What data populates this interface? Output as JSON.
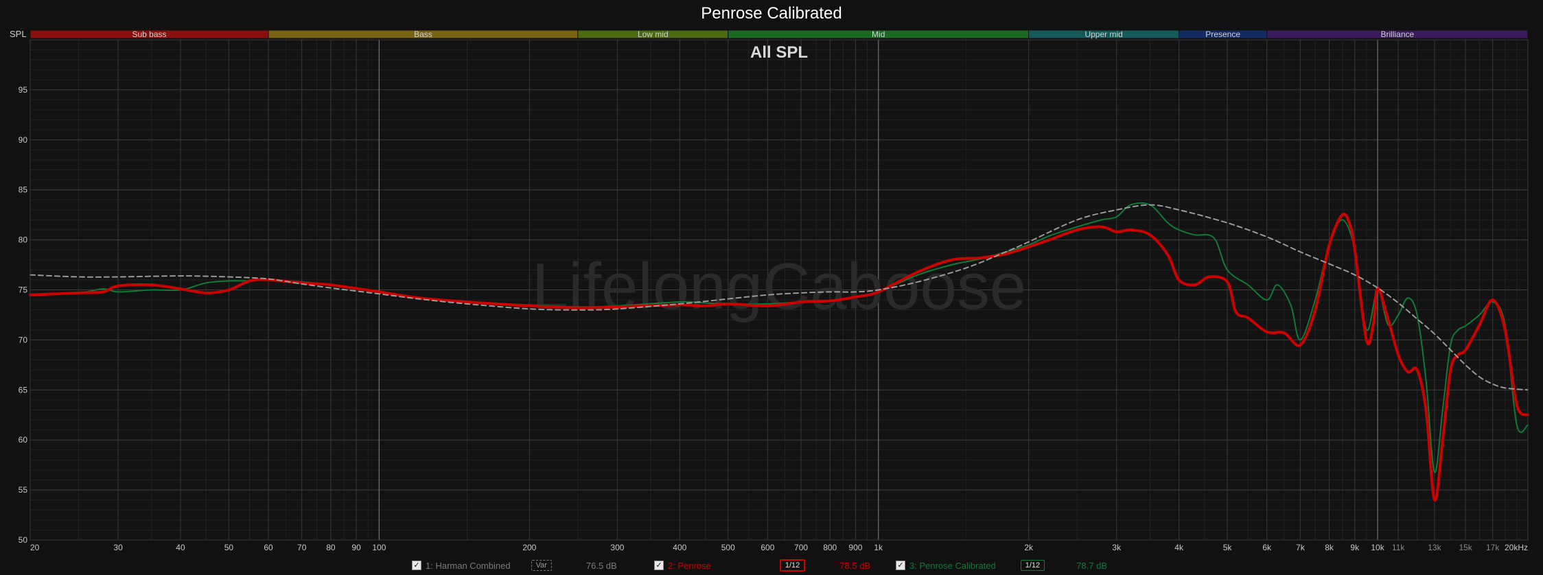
{
  "title": "Penrose Calibrated",
  "watermark": "LifelongCaboose",
  "colors": {
    "background": "#111111",
    "plot_bg": "#131313",
    "grid_major": "#4a4a4a",
    "grid_minor": "#262626",
    "penrose": "#cc0000",
    "calibrated": "#0f7a3a",
    "harman": "#9a9a9a"
  },
  "legend": [
    {
      "checkbox": "✓",
      "label": "1: Harman Combined",
      "smoothing": "Var",
      "level": "76.5 dB",
      "color": "#7a7a7a"
    },
    {
      "checkbox": "✓",
      "label": "2: Penrose",
      "smoothing": "1/12",
      "level": "78.5 dB",
      "color": "#cc0000"
    },
    {
      "checkbox": "✓",
      "label": "3: Penrose Calibrated",
      "smoothing": "1/12",
      "level": "78.7 dB",
      "color": "#0f7a3a"
    }
  ],
  "chart_data": {
    "type": "line",
    "title": "All SPL",
    "ylabel": "SPL",
    "x_scale": "log",
    "xlim": [
      20,
      20000
    ],
    "ylim": [
      50,
      100
    ],
    "grid": true,
    "y_ticks": [
      "50",
      "55",
      "60",
      "65",
      "70",
      "75",
      "80",
      "85",
      "90",
      "95"
    ],
    "x_ticks": [
      {
        "f": 20,
        "label": "20"
      },
      {
        "f": 30,
        "label": "30"
      },
      {
        "f": 40,
        "label": "40"
      },
      {
        "f": 50,
        "label": "50"
      },
      {
        "f": 60,
        "label": "60"
      },
      {
        "f": 70,
        "label": "70"
      },
      {
        "f": 80,
        "label": "80"
      },
      {
        "f": 90,
        "label": "90"
      },
      {
        "f": 100,
        "label": "100"
      },
      {
        "f": 200,
        "label": "200"
      },
      {
        "f": 300,
        "label": "300"
      },
      {
        "f": 400,
        "label": "400"
      },
      {
        "f": 500,
        "label": "500"
      },
      {
        "f": 600,
        "label": "600"
      },
      {
        "f": 700,
        "label": "700"
      },
      {
        "f": 800,
        "label": "800"
      },
      {
        "f": 900,
        "label": "900"
      },
      {
        "f": 1000,
        "label": "1k"
      },
      {
        "f": 2000,
        "label": "2k"
      },
      {
        "f": 3000,
        "label": "3k"
      },
      {
        "f": 4000,
        "label": "4k"
      },
      {
        "f": 5000,
        "label": "5k"
      },
      {
        "f": 6000,
        "label": "6k"
      },
      {
        "f": 7000,
        "label": "7k"
      },
      {
        "f": 8000,
        "label": "8k"
      },
      {
        "f": 9000,
        "label": "9k"
      },
      {
        "f": 10000,
        "label": "10k"
      },
      {
        "f": 11000,
        "label": "11k"
      },
      {
        "f": 13000,
        "label": "13k"
      },
      {
        "f": 15000,
        "label": "15k"
      },
      {
        "f": 17000,
        "label": "17k"
      },
      {
        "f": 20000,
        "label": "20kHz"
      }
    ],
    "bands": [
      {
        "label": "Sub bass",
        "from": 20,
        "to": 60,
        "color": "#8a1010"
      },
      {
        "label": "Bass",
        "from": 60,
        "to": 250,
        "color": "#7a6214"
      },
      {
        "label": "Low mid",
        "from": 250,
        "to": 500,
        "color": "#4a6a14"
      },
      {
        "label": "Mid",
        "from": 500,
        "to": 2000,
        "color": "#1c6a22"
      },
      {
        "label": "Upper mid",
        "from": 2000,
        "to": 4000,
        "color": "#145a5a"
      },
      {
        "label": "Presence",
        "from": 4000,
        "to": 6000,
        "color": "#142a62"
      },
      {
        "label": "Brilliance",
        "from": 6000,
        "to": 20000,
        "color": "#3a1a5a"
      }
    ],
    "series": [
      {
        "name": "1: Harman Combined",
        "style": "dashed",
        "points": [
          [
            20,
            76.5
          ],
          [
            25,
            76.3
          ],
          [
            30,
            76.3
          ],
          [
            40,
            76.4
          ],
          [
            50,
            76.3
          ],
          [
            60,
            76.1
          ],
          [
            70,
            75.6
          ],
          [
            80,
            75.2
          ],
          [
            100,
            74.6
          ],
          [
            120,
            74.1
          ],
          [
            150,
            73.6
          ],
          [
            200,
            73.1
          ],
          [
            250,
            73.0
          ],
          [
            300,
            73.1
          ],
          [
            400,
            73.6
          ],
          [
            500,
            74.1
          ],
          [
            600,
            74.5
          ],
          [
            700,
            74.7
          ],
          [
            800,
            74.8
          ],
          [
            900,
            74.8
          ],
          [
            1000,
            75.0
          ],
          [
            1200,
            75.8
          ],
          [
            1500,
            77.2
          ],
          [
            1800,
            78.8
          ],
          [
            2000,
            79.8
          ],
          [
            2500,
            82.0
          ],
          [
            3000,
            83.0
          ],
          [
            3500,
            83.5
          ],
          [
            4000,
            83.0
          ],
          [
            5000,
            81.7
          ],
          [
            6000,
            80.3
          ],
          [
            7000,
            78.8
          ],
          [
            8000,
            77.6
          ],
          [
            9000,
            76.5
          ],
          [
            10000,
            75.2
          ],
          [
            11000,
            73.7
          ],
          [
            12000,
            72.1
          ],
          [
            13000,
            70.6
          ],
          [
            14000,
            69.0
          ],
          [
            15000,
            67.5
          ],
          [
            16000,
            66.3
          ],
          [
            17000,
            65.6
          ],
          [
            18000,
            65.2
          ],
          [
            20000,
            65.0
          ]
        ]
      },
      {
        "name": "2: Penrose",
        "style": "thick",
        "points": [
          [
            20,
            74.5
          ],
          [
            25,
            74.7
          ],
          [
            28,
            74.8
          ],
          [
            30,
            75.4
          ],
          [
            35,
            75.5
          ],
          [
            40,
            75.1
          ],
          [
            45,
            74.7
          ],
          [
            50,
            75.0
          ],
          [
            55,
            75.9
          ],
          [
            60,
            76.0
          ],
          [
            70,
            75.7
          ],
          [
            80,
            75.5
          ],
          [
            100,
            74.8
          ],
          [
            120,
            74.2
          ],
          [
            150,
            73.8
          ],
          [
            200,
            73.4
          ],
          [
            250,
            73.2
          ],
          [
            300,
            73.3
          ],
          [
            400,
            73.5
          ],
          [
            450,
            73.4
          ],
          [
            500,
            73.6
          ],
          [
            600,
            73.4
          ],
          [
            700,
            73.8
          ],
          [
            800,
            73.9
          ],
          [
            900,
            74.3
          ],
          [
            1000,
            74.8
          ],
          [
            1200,
            76.8
          ],
          [
            1400,
            78.0
          ],
          [
            1600,
            78.2
          ],
          [
            1800,
            78.6
          ],
          [
            2000,
            79.3
          ],
          [
            2200,
            80.0
          ],
          [
            2500,
            81.0
          ],
          [
            2800,
            81.3
          ],
          [
            3000,
            80.8
          ],
          [
            3200,
            81.0
          ],
          [
            3500,
            80.5
          ],
          [
            3800,
            78.5
          ],
          [
            4000,
            76.0
          ],
          [
            4300,
            75.5
          ],
          [
            4600,
            76.3
          ],
          [
            5000,
            75.8
          ],
          [
            5200,
            72.8
          ],
          [
            5500,
            72.2
          ],
          [
            6000,
            70.8
          ],
          [
            6500,
            70.7
          ],
          [
            7000,
            69.5
          ],
          [
            7500,
            73.0
          ],
          [
            8000,
            79.5
          ],
          [
            8500,
            82.5
          ],
          [
            8800,
            81.5
          ],
          [
            9000,
            79.0
          ],
          [
            9500,
            70.0
          ],
          [
            9800,
            71.5
          ],
          [
            10000,
            75.2
          ],
          [
            10500,
            72.0
          ],
          [
            11000,
            68.5
          ],
          [
            11500,
            66.8
          ],
          [
            12000,
            67.0
          ],
          [
            12500,
            63.0
          ],
          [
            13000,
            54.0
          ],
          [
            13500,
            60.0
          ],
          [
            14000,
            67.0
          ],
          [
            14500,
            68.5
          ],
          [
            15000,
            69.0
          ],
          [
            16000,
            71.5
          ],
          [
            17000,
            74.0
          ],
          [
            18000,
            71.0
          ],
          [
            19000,
            63.5
          ],
          [
            20000,
            62.5
          ]
        ]
      },
      {
        "name": "3: Penrose Calibrated",
        "style": "thin",
        "points": [
          [
            20,
            74.5
          ],
          [
            25,
            74.7
          ],
          [
            28,
            75.1
          ],
          [
            30,
            74.8
          ],
          [
            35,
            75.0
          ],
          [
            40,
            75.0
          ],
          [
            45,
            75.7
          ],
          [
            50,
            75.9
          ],
          [
            55,
            75.9
          ],
          [
            60,
            76.0
          ],
          [
            70,
            75.8
          ],
          [
            80,
            75.5
          ],
          [
            100,
            74.8
          ],
          [
            120,
            74.2
          ],
          [
            150,
            73.8
          ],
          [
            200,
            73.5
          ],
          [
            250,
            73.3
          ],
          [
            300,
            73.4
          ],
          [
            400,
            73.8
          ],
          [
            450,
            73.7
          ],
          [
            500,
            73.6
          ],
          [
            600,
            73.6
          ],
          [
            700,
            73.8
          ],
          [
            800,
            73.9
          ],
          [
            900,
            74.3
          ],
          [
            1000,
            74.8
          ],
          [
            1200,
            76.5
          ],
          [
            1400,
            77.5
          ],
          [
            1600,
            78.1
          ],
          [
            1800,
            78.8
          ],
          [
            2000,
            79.5
          ],
          [
            2200,
            80.4
          ],
          [
            2500,
            81.3
          ],
          [
            2800,
            82.0
          ],
          [
            3000,
            82.3
          ],
          [
            3200,
            83.5
          ],
          [
            3500,
            83.5
          ],
          [
            3800,
            81.7
          ],
          [
            4000,
            81.0
          ],
          [
            4300,
            80.5
          ],
          [
            4700,
            80.2
          ],
          [
            5000,
            77.0
          ],
          [
            5500,
            75.5
          ],
          [
            6000,
            74.0
          ],
          [
            6300,
            75.5
          ],
          [
            6700,
            73.5
          ],
          [
            7000,
            70.0
          ],
          [
            7500,
            74.0
          ],
          [
            8000,
            79.5
          ],
          [
            8500,
            82.0
          ],
          [
            9000,
            79.0
          ],
          [
            9500,
            71.0
          ],
          [
            10000,
            75.0
          ],
          [
            10500,
            71.5
          ],
          [
            11000,
            72.5
          ],
          [
            11500,
            74.2
          ],
          [
            12000,
            72.5
          ],
          [
            12500,
            66.0
          ],
          [
            13000,
            56.8
          ],
          [
            13500,
            63.0
          ],
          [
            14000,
            69.5
          ],
          [
            14500,
            71.0
          ],
          [
            15000,
            71.4
          ],
          [
            16000,
            72.5
          ],
          [
            17000,
            73.8
          ],
          [
            18000,
            71.5
          ],
          [
            19000,
            61.5
          ],
          [
            20000,
            61.5
          ]
        ]
      }
    ]
  }
}
